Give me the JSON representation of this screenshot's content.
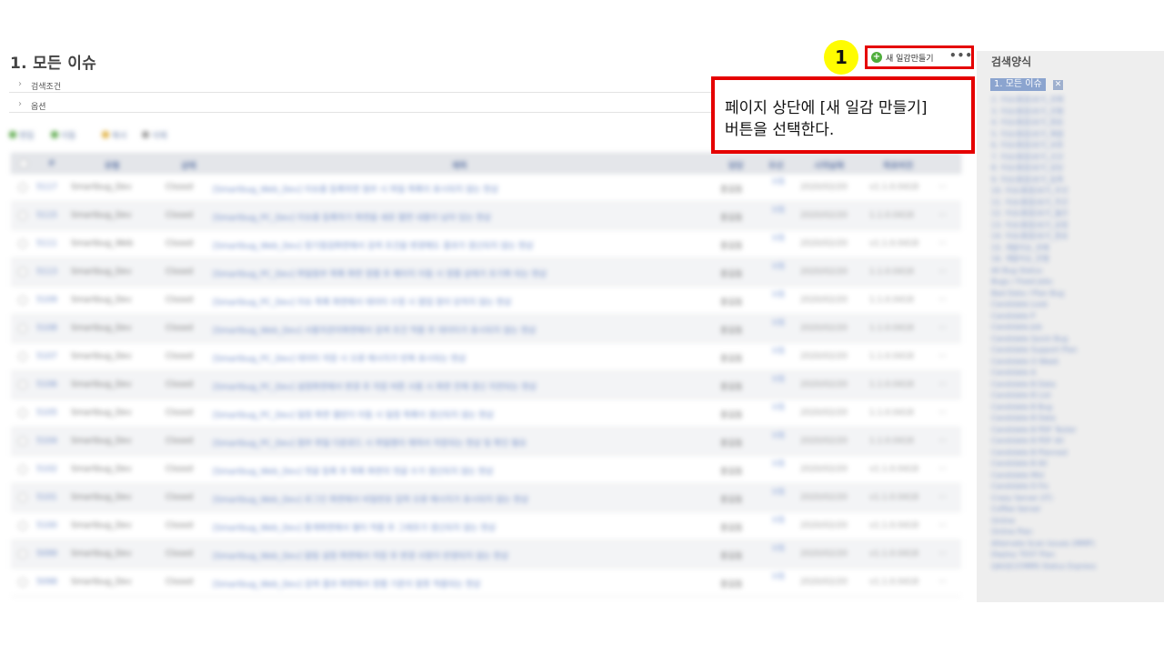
{
  "page": {
    "title": "1. 모든 이슈",
    "search_conditions_label": "검색조건",
    "options_label": "옵션"
  },
  "actions": [
    {
      "label": "편집",
      "color": "#5aa84a"
    },
    {
      "label": "이동",
      "color": "#5aa84a"
    },
    {
      "label": "복사",
      "color": "#e0b040"
    },
    {
      "label": "삭제",
      "color": "#999999"
    }
  ],
  "table": {
    "columns": [
      "#",
      "유형",
      "상태",
      "제목",
      "담당",
      "우선",
      "시작날짜",
      "목표버전"
    ],
    "rows": [
      {
        "id": "5117",
        "project": "Smartbug_Dev",
        "status": "Closed",
        "subject": "[Smartbug_Web_Dev] 이슈를 등록하면 첨부 시 파일 목록이 표시되지 않는 현상",
        "assignee": "홍길동",
        "priority": "보통",
        "date": "2020/02/20",
        "version": "v1.1.0.0418"
      },
      {
        "id": "5115",
        "project": "Smartbug_Dev",
        "status": "Closed",
        "subject": "[Smartbug_PC_Dev] 이슈를 등록하기 화면을 새로 열면 내용이 남아 있는 현상",
        "assignee": "홍길동",
        "priority": "보통",
        "date": "2020/02/20",
        "version": "1.1.0.0418"
      },
      {
        "id": "5111",
        "project": "Smartbug_Web",
        "status": "Closed",
        "subject": "[Smartbug_Web_Dev] 정기점검화면에서 검색 조건을 변경해도 결과가 갱신되지 않는 현상",
        "assignee": "홍길동",
        "priority": "보통",
        "date": "2020/02/20",
        "version": "v1.1.0.0418"
      },
      {
        "id": "5113",
        "project": "Smartbug_Dev",
        "status": "Closed",
        "subject": "[Smartbug_PC_Dev] 파일첨부 목록 화면 정렬 후 페이지 이동 시 정렬 상태가 초기화 되는 현상",
        "assignee": "홍길동",
        "priority": "보통",
        "date": "2020/02/20",
        "version": "1.1.0.0418"
      },
      {
        "id": "5109",
        "project": "Smartbug_Dev",
        "status": "Closed",
        "subject": "[Smartbug_PC_Dev] 이슈 목록 화면에서 데이터 수정 시 팝업 창이 닫히지 않는 현상",
        "assignee": "홍길동",
        "priority": "보통",
        "date": "2020/02/20",
        "version": "1.1.0.0418"
      },
      {
        "id": "5108",
        "project": "Smartbug_Dev",
        "status": "Closed",
        "subject": "[Smartbug_Web_Dev] 사용자관리화면에서 검색 조건 적용 후 데이터가 표시되지 않는 현상",
        "assignee": "홍길동",
        "priority": "보통",
        "date": "2020/02/20",
        "version": "1.1.0.0418"
      },
      {
        "id": "5107",
        "project": "Smartbug_Dev",
        "status": "Closed",
        "subject": "[Smartbug_PC_Dev] 데이터 저장 시 오류 메시지가 반복 표시되는 현상",
        "assignee": "홍길동",
        "priority": "보통",
        "date": "2020/02/20",
        "version": "1.1.0.0418"
      },
      {
        "id": "5106",
        "project": "Smartbug_Dev",
        "status": "Closed",
        "subject": "[Smartbug_PC_Dev] 설정화면에서 변경 후 저장 버튼 사용 시 화면 전체 갱신 지연되는 현상",
        "assignee": "홍길동",
        "priority": "보통",
        "date": "2020/02/20",
        "version": "1.1.0.0418"
      },
      {
        "id": "5105",
        "project": "Smartbug_Dev",
        "status": "Closed",
        "subject": "[Smartbug_PC_Dev] 일정 화면 캘린더 이동 시 일정 목록이 갱신되지 않는 현상",
        "assignee": "홍길동",
        "priority": "보통",
        "date": "2020/02/20",
        "version": "1.1.0.0418"
      },
      {
        "id": "5104",
        "project": "Smartbug_Dev",
        "status": "Closed",
        "subject": "[Smartbug_PC_Dev] 첨부 파일 다운로드 시 파일명이 깨져서 저장되는 현상 및 확인 필요",
        "assignee": "홍길동",
        "priority": "보통",
        "date": "2020/02/20",
        "version": "1.1.0.0418"
      },
      {
        "id": "5102",
        "project": "Smartbug_Dev",
        "status": "Closed",
        "subject": "[Smartbug_Web_Dev] 댓글 등록 후 목록 화면의 댓글 수가 갱신되지 않는 현상",
        "assignee": "홍길동",
        "priority": "보통",
        "date": "2020/02/20",
        "version": "v1.1.0.0418"
      },
      {
        "id": "5101",
        "project": "Smartbug_Dev",
        "status": "Closed",
        "subject": "[Smartbug_Web_Dev] 로그인 화면에서 비밀번호 입력 오류 메시지가 표시되지 않는 현상",
        "assignee": "홍길동",
        "priority": "보통",
        "date": "2020/02/20",
        "version": "v1.1.0.0418"
      },
      {
        "id": "5100",
        "project": "Smartbug_Dev",
        "status": "Closed",
        "subject": "[Smartbug_Web_Dev] 통계화면에서 필터 적용 후 그래프가 갱신되지 않는 현상",
        "assignee": "홍길동",
        "priority": "보통",
        "date": "2020/02/20",
        "version": "v1.1.0.0418"
      },
      {
        "id": "5099",
        "project": "Smartbug_Dev",
        "status": "Closed",
        "subject": "[Smartbug_Web_Dev] 알림 설정 화면에서 저장 후 변경 사항이 반영되지 않는 현상",
        "assignee": "홍길동",
        "priority": "보통",
        "date": "2020/02/20",
        "version": "v1.1.0.0418"
      },
      {
        "id": "5098",
        "project": "Smartbug_Dev",
        "status": "Closed",
        "subject": "[Smartbug_Web_Dev] 검색 결과 화면에서 정렬 기준이 잘못 적용되는 현상",
        "assignee": "홍길동",
        "priority": "보통",
        "date": "2020/02/20",
        "version": "v1.1.0.0418"
      }
    ]
  },
  "toolbar": {
    "new_calendar_label": "새 일감만들기",
    "more_label": "•••"
  },
  "annotation": {
    "step_number": "1",
    "callout_line1": "페이지 상단에 [새 일감 만들기]",
    "callout_line2": "버튼을 선택한다.",
    "highlight_color": "#e50000",
    "badge_color": "#fffc00"
  },
  "sidebar": {
    "title": "검색양식",
    "current": "1. 모든 이슈",
    "items": [
      "2. 이슈(통합)보기_전체",
      "3. 이슈(통합)보기_진행",
      "4. 이슈(통합)보기_완료",
      "5. 이슈(통합)보기_해결",
      "6. 이슈(통합)보기_보류",
      "7. 이슈(통합)보기_신규",
      "8. 이슈(통합)보기_담당",
      "9. 이슈(통합)보기_등록",
      "10. 이슈(통합)보기_우선",
      "11. 이슈(통합)보기_주간",
      "12. 이슈(통합)보기_월간",
      "13. 이슈(통합)보기_요청",
      "14. 이슈(통합)보기_종료",
      "15. 개발이슈_전체",
      "16. 개발이슈_진행",
      "All Bug Status",
      "Bugs / Fixed Jobs",
      "Bad Data / Plan Bug",
      "Candidate Look",
      "Candidate P",
      "Candidate Job",
      "Candidate Quick Bug",
      "Candidate Support Plan",
      "Candidate O Week",
      "Candidate A",
      "Candidate B Data",
      "Candidate B List",
      "Candidate B Bug",
      "Candidate B Data",
      "Candidate B PDF Tester",
      "Candidate B PDF All",
      "Candidate B Planned",
      "Candidate B All",
      "Candidate Mid",
      "Candidate D Fix",
      "Crazy Server (IT)",
      "Coffee Server",
      "Online",
      "Online Plan",
      "Alternate Scan Issues (MMP)",
      "Deploy TEST Plan",
      "QA/QC/CMMS Status Express"
    ]
  }
}
